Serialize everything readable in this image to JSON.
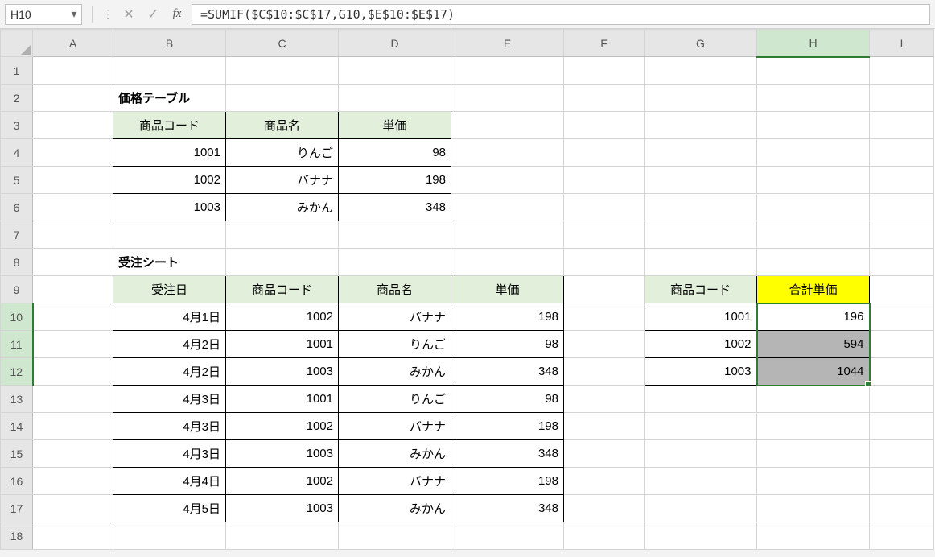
{
  "nameBox": "H10",
  "formula": "=SUMIF($C$10:$C$17,G10,$E$10:$E$17)",
  "columns": [
    "A",
    "B",
    "C",
    "D",
    "E",
    "F",
    "G",
    "H",
    "I"
  ],
  "selectedCol": "H",
  "rowCount": 18,
  "selectedRows": [
    10,
    11,
    12
  ],
  "labels": {
    "priceTableTitle": "価格テーブル",
    "orderSheetTitle": "受注シート",
    "productCode": "商品コード",
    "productName": "商品名",
    "unitPrice": "単価",
    "orderDate": "受注日",
    "totalPrice": "合計単価"
  },
  "priceTable": [
    {
      "code": "1001",
      "name": "りんご",
      "price": "98"
    },
    {
      "code": "1002",
      "name": "バナナ",
      "price": "198"
    },
    {
      "code": "1003",
      "name": "みかん",
      "price": "348"
    }
  ],
  "orders": [
    {
      "date": "4月1日",
      "code": "1002",
      "name": "バナナ",
      "price": "198"
    },
    {
      "date": "4月2日",
      "code": "1001",
      "name": "りんご",
      "price": "98"
    },
    {
      "date": "4月2日",
      "code": "1003",
      "name": "みかん",
      "price": "348"
    },
    {
      "date": "4月3日",
      "code": "1001",
      "name": "りんご",
      "price": "98"
    },
    {
      "date": "4月3日",
      "code": "1002",
      "name": "バナナ",
      "price": "198"
    },
    {
      "date": "4月3日",
      "code": "1003",
      "name": "みかん",
      "price": "348"
    },
    {
      "date": "4月4日",
      "code": "1002",
      "name": "バナナ",
      "price": "198"
    },
    {
      "date": "4月5日",
      "code": "1003",
      "name": "みかん",
      "price": "348"
    }
  ],
  "summary": [
    {
      "code": "1001",
      "total": "196"
    },
    {
      "code": "1002",
      "total": "594"
    },
    {
      "code": "1003",
      "total": "1044"
    }
  ]
}
